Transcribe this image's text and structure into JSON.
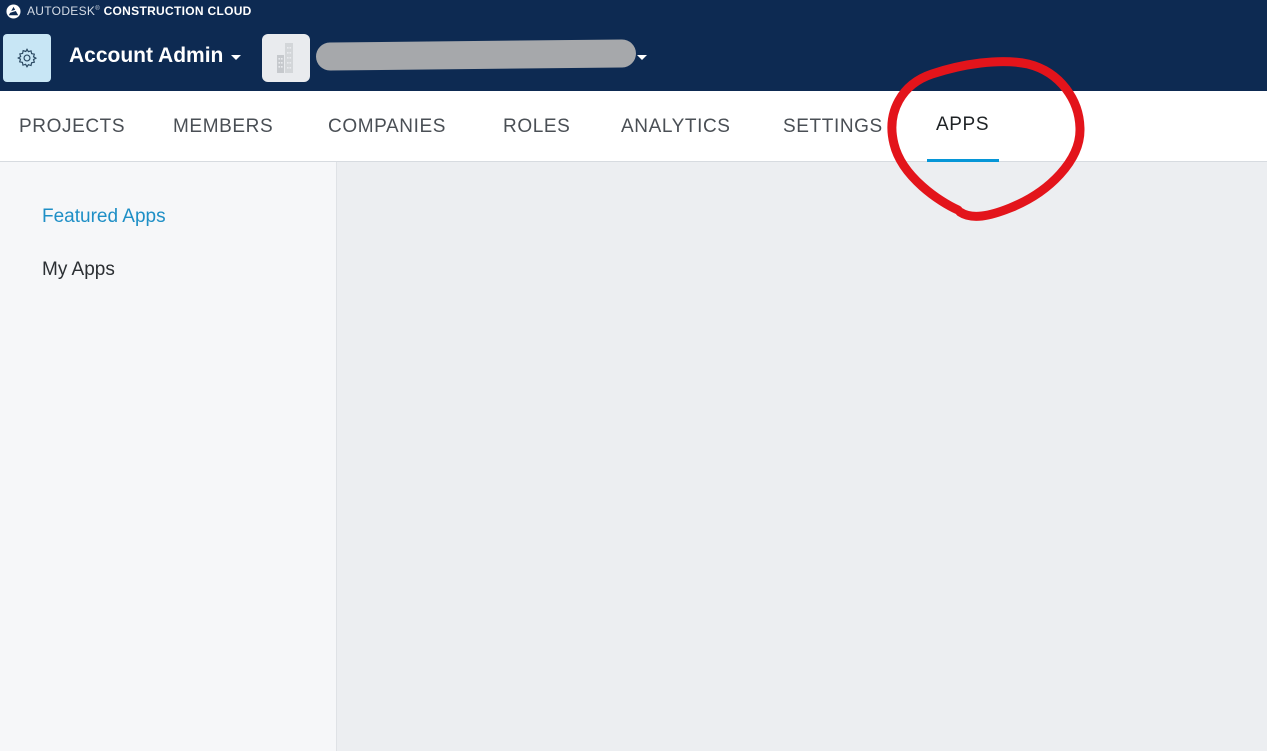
{
  "brand": {
    "prefix": "AUTODESK",
    "product": "CONSTRUCTION CLOUD"
  },
  "header": {
    "account_label": "Account Admin",
    "settings_icon": "gear-icon",
    "project_icon": "building-icon",
    "project_name_redacted": true
  },
  "tabs": [
    {
      "label": "PROJECTS",
      "active": false
    },
    {
      "label": "MEMBERS",
      "active": false
    },
    {
      "label": "COMPANIES",
      "active": false
    },
    {
      "label": "ROLES",
      "active": false
    },
    {
      "label": "ANALYTICS",
      "active": false
    },
    {
      "label": "SETTINGS",
      "active": false
    },
    {
      "label": "APPS",
      "active": true
    }
  ],
  "sidebar": {
    "items": [
      {
        "label": "Featured Apps",
        "selected": true
      },
      {
        "label": "My Apps",
        "selected": false
      }
    ]
  },
  "colors": {
    "header_bg": "#0d2a52",
    "accent": "#0696d7",
    "selected_link": "#1e8fc6",
    "annotation": "#e3141b"
  }
}
